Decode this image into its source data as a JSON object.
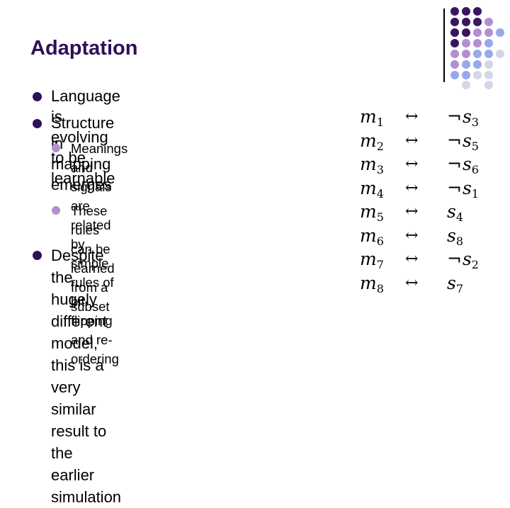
{
  "slide": {
    "title": "Adaptation",
    "bullets": [
      {
        "level": 1,
        "text": "Language is evolving to be learnable"
      },
      {
        "level": 1,
        "text": "Structure in mapping emerges"
      },
      {
        "level": 2,
        "lines": [
          "Meanings and signals are related by",
          "simple rules of bit flipping and re-",
          "ordering"
        ]
      },
      {
        "level": 2,
        "lines": [
          "These rules can be learned from a",
          "subset"
        ]
      },
      {
        "level": 1,
        "lines": [
          "Despite the hugely different model,",
          "this is a very similar result to the",
          "earlier simulation"
        ]
      }
    ],
    "mapping": [
      {
        "meaning": "m",
        "meaning_index": "1",
        "arrow": "↔",
        "negated": true,
        "signal": "s",
        "signal_index": "3"
      },
      {
        "meaning": "m",
        "meaning_index": "2",
        "arrow": "↔",
        "negated": true,
        "signal": "s",
        "signal_index": "5"
      },
      {
        "meaning": "m",
        "meaning_index": "3",
        "arrow": "↔",
        "negated": true,
        "signal": "s",
        "signal_index": "6"
      },
      {
        "meaning": "m",
        "meaning_index": "4",
        "arrow": "↔",
        "negated": true,
        "signal": "s",
        "signal_index": "1"
      },
      {
        "meaning": "m",
        "meaning_index": "5",
        "arrow": "↔",
        "negated": false,
        "signal": "s",
        "signal_index": "4"
      },
      {
        "meaning": "m",
        "meaning_index": "6",
        "arrow": "↔",
        "negated": false,
        "signal": "s",
        "signal_index": "8"
      },
      {
        "meaning": "m",
        "meaning_index": "7",
        "arrow": "↔",
        "negated": true,
        "signal": "s",
        "signal_index": "2"
      },
      {
        "meaning": "m",
        "meaning_index": "8",
        "arrow": "↔",
        "negated": false,
        "signal": "s",
        "signal_index": "7"
      }
    ],
    "negation_symbol": "¬"
  },
  "theme": {
    "title_color": "#2e0f5a",
    "bullet_l1_color": "#2e0f5a",
    "bullet_l2_color": "#b48fd0",
    "dot_colors": {
      "D": "#3a1660",
      "L": "#b48fd0",
      "B": "#95a9ec",
      "G": "#d3d6e8"
    },
    "dot_grid": [
      "DDD",
      "DDDL",
      "DDLLB",
      "DLLB",
      "LLBBG",
      "LBBG",
      "BBGG",
      ".G.G"
    ]
  }
}
